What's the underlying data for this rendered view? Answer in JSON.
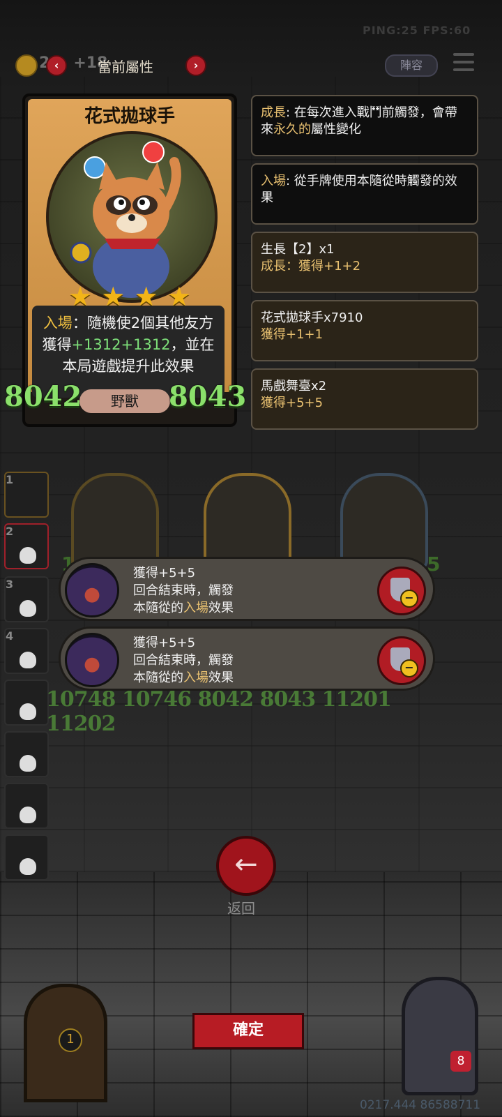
{
  "status": {
    "ping_fps": "PING:25   FPS:60"
  },
  "top_bar": {
    "gold_value": "2",
    "gold_bonus": "+18",
    "title": "當前屬性",
    "prev_icon": "chevron-left-icon",
    "next_icon": "chevron-right-icon",
    "lineup_label": "陣容",
    "menu_icon": "menu-icon"
  },
  "card": {
    "name": "花式拋球手",
    "stars": 4,
    "desc_kw": "入場",
    "desc_a": "：隨機使2個其他友方獲得",
    "desc_v1": "+1312",
    "desc_v2": "+1312",
    "desc_b": "，並在本局遊戲提升此效果",
    "attack": "8042",
    "health": "8043",
    "tribe": "野獸"
  },
  "info_panels": [
    {
      "kw": "成長",
      "text_a": ": 在每次進入戰鬥前觸發，會帶來",
      "highlight": "永久的",
      "text_b": "屬性變化"
    },
    {
      "kw": "入場",
      "text_a": ": 從手牌使用本隨從時觸發的效果"
    },
    {
      "line1": "生長【2】x1",
      "kw": "成長",
      "line2": "：獲得+1+2"
    },
    {
      "line1": "花式拋球手x7910",
      "line2": "獲得+1+1"
    },
    {
      "line1": "馬戲舞臺x2",
      "line2": "獲得+5+5"
    }
  ],
  "board": {
    "numbers": "10748 10746   8042 8043   11201 11202",
    "left_peek": "1",
    "right_peek": "5"
  },
  "side_slots": [
    "1",
    "2",
    "3",
    "4",
    "",
    "",
    "",
    ""
  ],
  "effects": [
    {
      "line1": "獲得+5+5",
      "line2": "回合結束時，觸發",
      "line3a": "本隨從的",
      "line3kw": "入場",
      "line3b": "效果"
    },
    {
      "line1": "獲得+5+5",
      "line2": "回合結束時，觸發",
      "line3a": "本隨從的",
      "line3kw": "入場",
      "line3b": "效果"
    }
  ],
  "back_label": "返回",
  "confirm_label": "確定",
  "door_badge": "1",
  "heart_count": "8",
  "coords": "0217.444 86588711",
  "colors": {
    "accent_red": "#b71c24",
    "gold_text": "#e8c070",
    "green_stat": "#8be06b",
    "star": "#f2b418"
  }
}
